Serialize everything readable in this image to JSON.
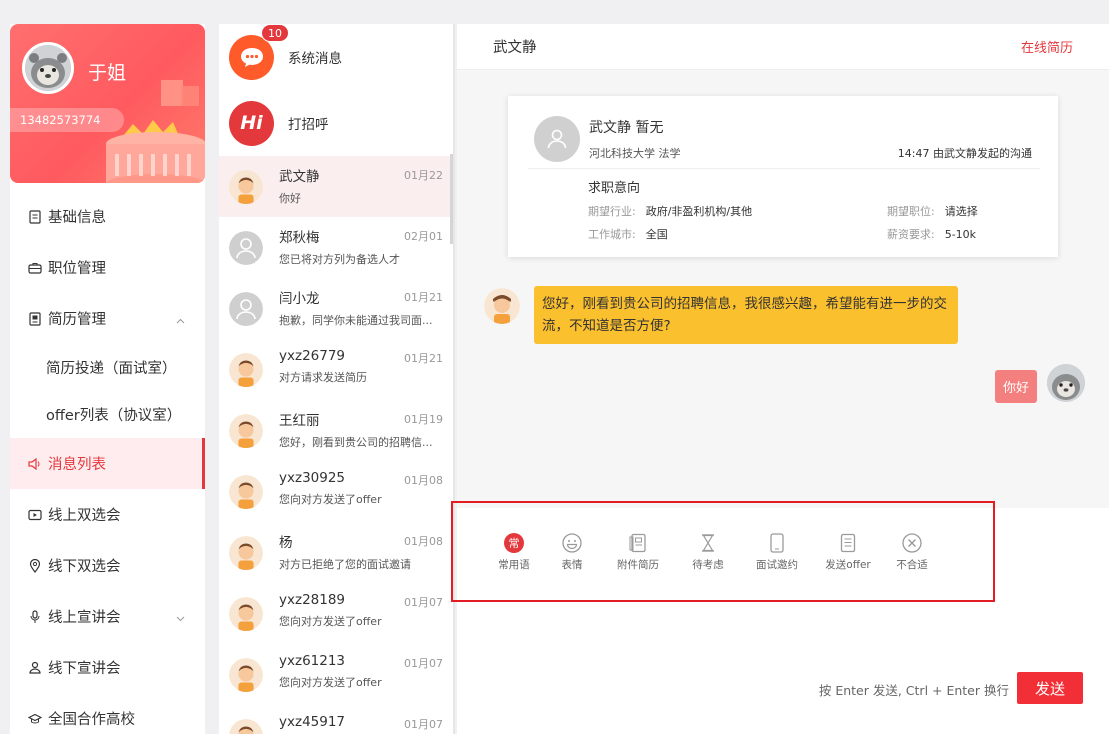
{
  "profile": {
    "name": "于姐",
    "phone": "13482573774"
  },
  "menu": {
    "items": [
      {
        "label": "基础信息"
      },
      {
        "label": "职位管理"
      },
      {
        "label": "简历管理"
      },
      {
        "label": "简历投递（面试室）"
      },
      {
        "label": "offer列表（协议室）"
      },
      {
        "label": "消息列表"
      },
      {
        "label": "线上双选会"
      },
      {
        "label": "线下双选会"
      },
      {
        "label": "线上宣讲会"
      },
      {
        "label": "线下宣讲会"
      },
      {
        "label": "全国合作高校"
      }
    ]
  },
  "system": {
    "messages": {
      "label": "系统消息",
      "badge": "10"
    },
    "greeting": {
      "label": "打招呼",
      "icon_text": "Hi"
    }
  },
  "conversations": [
    {
      "name": "武文静",
      "date": "01月22",
      "preview": "你好"
    },
    {
      "name": "郑秋梅",
      "date": "02月01",
      "preview": "您已将对方列为备选人才"
    },
    {
      "name": "闫小龙",
      "date": "01月21",
      "preview": "抱歉，同学你未能通过我司面..."
    },
    {
      "name": "yxz26779",
      "date": "01月21",
      "preview": "对方请求发送简历"
    },
    {
      "name": "王红丽",
      "date": "01月19",
      "preview": "您好，刚看到贵公司的招聘信..."
    },
    {
      "name": "yxz30925",
      "date": "01月08",
      "preview": "您向对方发送了offer"
    },
    {
      "name": "杨",
      "date": "01月08",
      "preview": "对方已拒绝了您的面试邀请"
    },
    {
      "name": "yxz28189",
      "date": "01月07",
      "preview": "您向对方发送了offer"
    },
    {
      "name": "yxz61213",
      "date": "01月07",
      "preview": "您向对方发送了offer"
    },
    {
      "name": "yxz45917",
      "date": "01月07",
      "preview": ""
    }
  ],
  "chat": {
    "header": {
      "name": "武文静",
      "resume_link": "在线简历"
    },
    "card": {
      "name_line": "武文静  暂无",
      "school_major": "河北科技大学  法学",
      "time_note": "14:47  由武文静发起的沟通",
      "intent_title": "求职意向",
      "industry_label": "期望行业:",
      "industry_value": "政府/非盈利机构/其他",
      "position_label": "期望职位:",
      "position_value": "请选择",
      "city_label": "工作城市:",
      "city_value": "全国",
      "salary_label": "薪资要求:",
      "salary_value": "5-10k"
    },
    "incoming_message": "您好，刚看到贵公司的招聘信息，我很感兴趣，希望能有进一步的交流，不知道是否方便?",
    "outgoing_message": "你好",
    "tools": [
      {
        "label": "常用语",
        "icon": "common-phrase-icon",
        "icon_text": "常"
      },
      {
        "label": "表情",
        "icon": "emoji-icon"
      },
      {
        "label": "附件简历",
        "icon": "attachment-resume-icon"
      },
      {
        "label": "待考虑",
        "icon": "hourglass-icon"
      },
      {
        "label": "面试邀约",
        "icon": "interview-invite-icon"
      },
      {
        "label": "发送offer",
        "icon": "send-offer-icon"
      },
      {
        "label": "不合适",
        "icon": "reject-icon"
      }
    ],
    "hint": "按 Enter 发送, Ctrl + Enter 换行",
    "send_label": "发送"
  },
  "colors": {
    "accent": "#e4393c",
    "incoming_bubble": "#fbc02d",
    "outgoing_bubble": "#f47f7f",
    "highlight_box": "#e31b23"
  }
}
